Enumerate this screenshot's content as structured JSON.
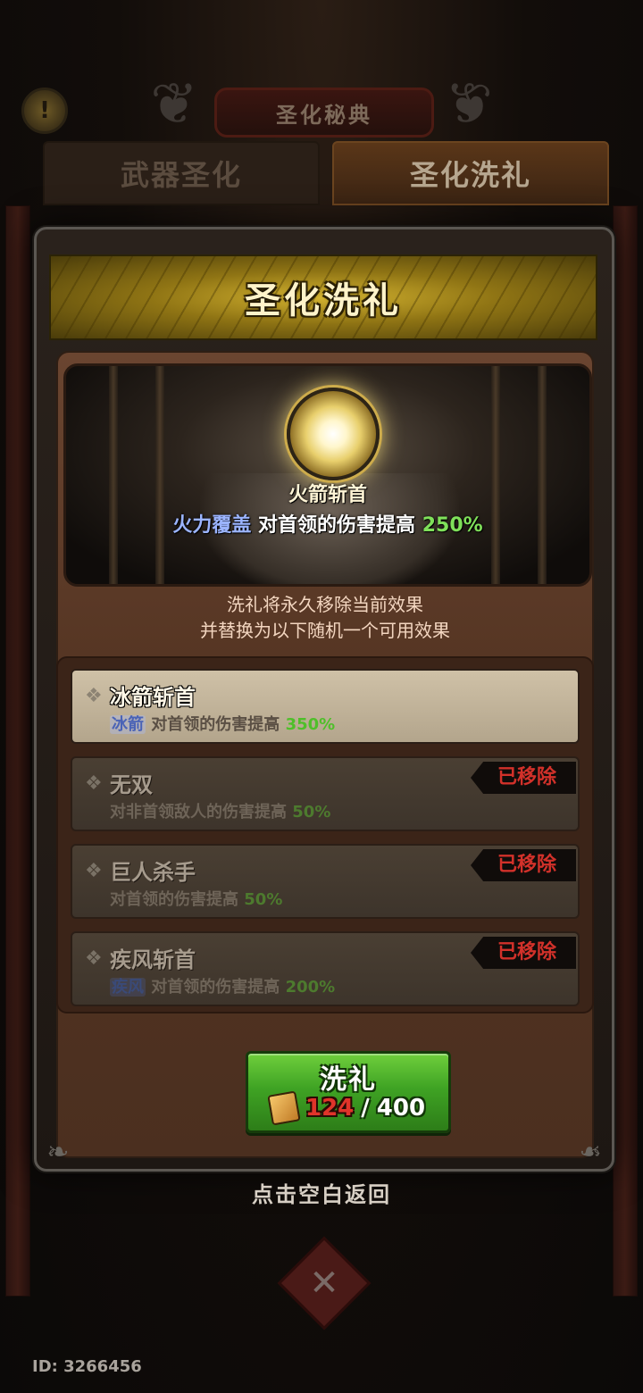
{
  "background": {
    "alert_icon": "!",
    "page_title": "圣化秘典",
    "tabs": [
      {
        "label": "武器圣化"
      },
      {
        "label": "圣化洗礼"
      }
    ]
  },
  "modal": {
    "title": "圣化洗礼",
    "current": {
      "name": "火箭斩首",
      "keyword": "火力覆盖",
      "effect": "对首领的伤害提高",
      "value": "250%"
    },
    "notice_line1": "洗礼将永久移除当前效果",
    "notice_line2": "并替换为以下随机一个可用效果",
    "options": [
      {
        "name": "冰箭斩首",
        "tag": "冰箭",
        "effect": "对首领的伤害提高",
        "value": "350%",
        "removed": false
      },
      {
        "name": "无双",
        "tag": "",
        "effect": "对非首领敌人的伤害提高",
        "value": "50%",
        "removed": true,
        "badge": "已移除"
      },
      {
        "name": "巨人杀手",
        "tag": "",
        "effect": "对首领的伤害提高",
        "value": "50%",
        "removed": true,
        "badge": "已移除"
      },
      {
        "name": "疾风斩首",
        "tag": "疾风",
        "effect": "对首领的伤害提高",
        "value": "200%",
        "removed": true,
        "badge": "已移除"
      }
    ],
    "button": {
      "label": "洗礼",
      "cost_have": "124",
      "cost_sep": "/",
      "cost_need": "400",
      "cost_icon": "baptism-stone-icon"
    }
  },
  "back_hint": "点击空白返回",
  "user_id": "ID: 3266456",
  "colors": {
    "accent_gold": "#d4b330",
    "button_green": "#3fa324",
    "removed_red": "#d2312a",
    "value_green": "#7fe05a",
    "keyword_blue": "#9bb4ff"
  }
}
